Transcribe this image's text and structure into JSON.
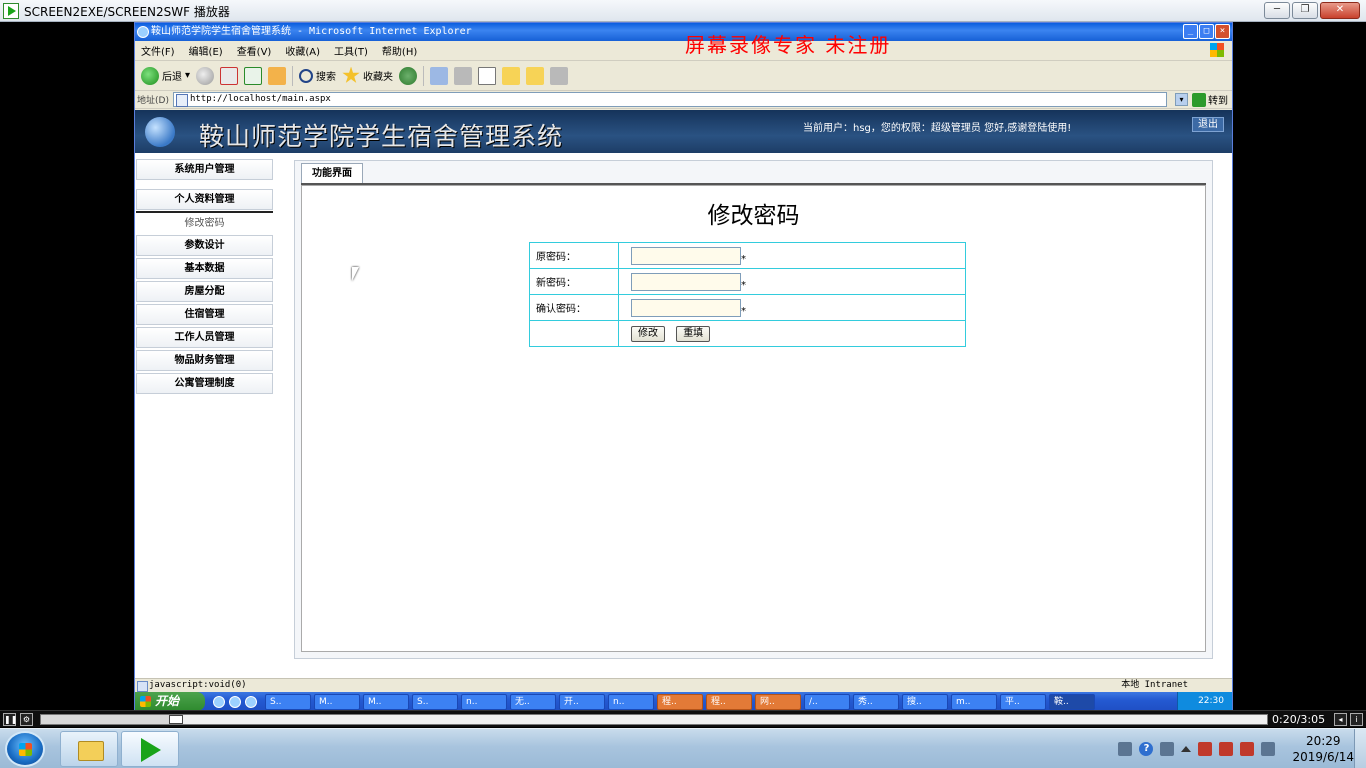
{
  "player": {
    "title": "SCREEN2EXE/SCREEN2SWF 播放器",
    "time": "0:20/3:05",
    "progress_fraction": 0.11
  },
  "ie": {
    "title": "鞍山师范学院学生宿舍管理系统 - Microsoft Internet Explorer",
    "watermark": "屏幕录像专家  未注册",
    "menu": [
      "文件(F)",
      "编辑(E)",
      "查看(V)",
      "收藏(A)",
      "工具(T)",
      "帮助(H)"
    ],
    "toolbar": {
      "back": "后退",
      "search": "搜索",
      "favorites": "收藏夹"
    },
    "address_label": "地址(D)",
    "address_value": "http://localhost/main.aspx",
    "go": "转到",
    "status_left": "javascript:void(0)",
    "status_right": "本地 Intranet"
  },
  "site": {
    "title": "鞍山师范学院学生宿舍管理系统",
    "user_info": "当前用户：hsg，您的权限：超级管理员  您好,感谢登陆使用!",
    "logout": "退出"
  },
  "sidebar": {
    "items": [
      "系统用户管理",
      "个人资料管理",
      "修改密码",
      "参数设计",
      "基本数据",
      "房屋分配",
      "住宿管理",
      "工作人员管理",
      "物品财务管理",
      "公寓管理制度"
    ]
  },
  "main": {
    "tab": "功能界面",
    "heading": "修改密码",
    "form": {
      "old_password_label": "原密码：",
      "new_password_label": "新密码：",
      "confirm_password_label": "确认密码：",
      "required_mark": "*",
      "submit": "修改",
      "reset": "重填"
    }
  },
  "xp_taskbar": {
    "start": "开始",
    "tasks": [
      "S..",
      "M..",
      "M..",
      "S..",
      "n..",
      "无..",
      "开..",
      "n..",
      "程..",
      "程..",
      "网..",
      "/..",
      "秀..",
      "搜..",
      "m..",
      "平..",
      "鞍.."
    ],
    "clock": "22:30"
  },
  "w7_taskbar": {
    "time": "20:29",
    "date": "2019/6/14"
  },
  "colors": {
    "form_border": "#33ccdd",
    "banner": "#1d3d66",
    "watermark": "#ff0000"
  }
}
